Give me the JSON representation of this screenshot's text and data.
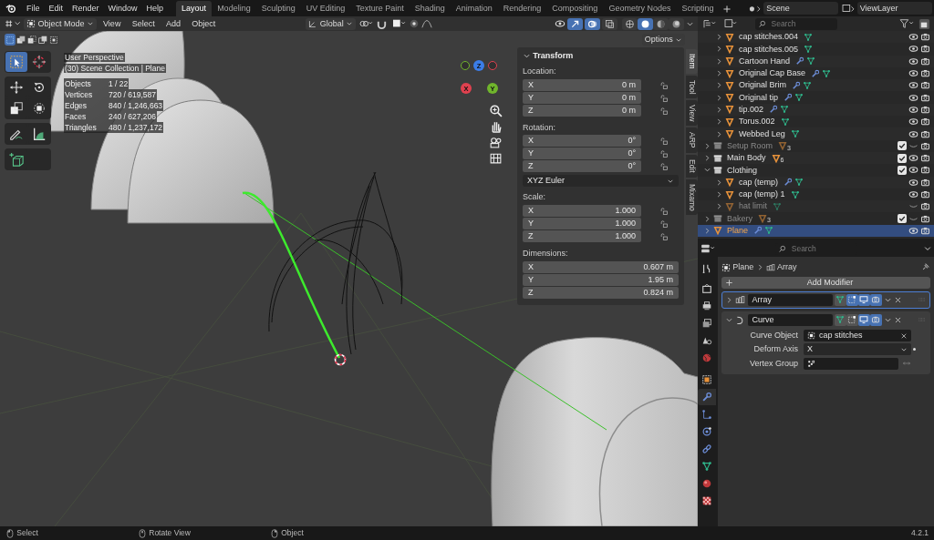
{
  "topbar": {
    "menus": [
      "File",
      "Edit",
      "Render",
      "Window",
      "Help"
    ],
    "workspaces": [
      {
        "label": "Layout",
        "selected": true
      },
      {
        "label": "Modeling",
        "selected": false
      },
      {
        "label": "Sculpting",
        "selected": false
      },
      {
        "label": "UV Editing",
        "selected": false
      },
      {
        "label": "Texture Paint",
        "selected": false
      },
      {
        "label": "Shading",
        "selected": false
      },
      {
        "label": "Animation",
        "selected": false
      },
      {
        "label": "Rendering",
        "selected": false
      },
      {
        "label": "Compositing",
        "selected": false
      },
      {
        "label": "Geometry Nodes",
        "selected": false
      },
      {
        "label": "Scripting",
        "selected": false
      }
    ],
    "scene": "Scene",
    "view_layer": "ViewLayer"
  },
  "viewport": {
    "mode": "Object Mode",
    "menus": [
      "View",
      "Select",
      "Add",
      "Object"
    ],
    "orientation": "Global",
    "options": "Options",
    "select_modes": [
      {
        "kind": "set",
        "selected": true
      },
      {
        "kind": "extend",
        "selected": false
      },
      {
        "kind": "subtract",
        "selected": false
      },
      {
        "kind": "invert",
        "selected": false
      },
      {
        "kind": "intersect",
        "selected": false
      }
    ],
    "toggles": [
      {
        "kind": "gizmo",
        "on": true
      },
      {
        "kind": "overlay",
        "on": true
      },
      {
        "kind": "xray",
        "on": false
      }
    ],
    "shading": [
      {
        "kind": "wireframe",
        "selected": false
      },
      {
        "kind": "solid",
        "selected": true
      },
      {
        "kind": "material",
        "selected": false
      },
      {
        "kind": "rendered",
        "selected": false
      }
    ],
    "view_name": "User Perspective",
    "collection": "(30) Scene Collection | Plane",
    "stats": [
      {
        "label": "Objects",
        "value": "1 / 22"
      },
      {
        "label": "Vertices",
        "value": "720 / 619,587"
      },
      {
        "label": "Edges",
        "value": "840 / 1,246,663"
      },
      {
        "label": "Faces",
        "value": "240 / 627,206"
      },
      {
        "label": "Triangles",
        "value": "480 / 1,237,172"
      }
    ],
    "tools": [
      {
        "kind": "select",
        "selected": true
      },
      {
        "kind": "cursor",
        "selected": false
      },
      {
        "kind": "move",
        "selected": false
      },
      {
        "kind": "rotate",
        "selected": false
      },
      {
        "kind": "scale",
        "selected": false
      },
      {
        "kind": "transform",
        "selected": false
      },
      {
        "kind": "annotate",
        "selected": false
      },
      {
        "kind": "measure",
        "selected": false
      },
      {
        "kind": "add-cube",
        "selected": false
      }
    ],
    "gizmo_axes": [
      {
        "label": "Z",
        "color": "#3b7de8"
      },
      {
        "label": "X",
        "color": "#e0414f"
      },
      {
        "label": "Y",
        "color": "#70b52c"
      }
    ]
  },
  "sidebar": {
    "title": "Transform",
    "groups": [
      {
        "kind": "vector",
        "label": "Location:",
        "locks": true,
        "fields": [
          {
            "axis": "X",
            "value": "0 m"
          },
          {
            "axis": "Y",
            "value": "0 m"
          },
          {
            "axis": "Z",
            "value": "0 m"
          }
        ]
      },
      {
        "kind": "vector",
        "label": "Rotation:",
        "locks": true,
        "fields": [
          {
            "axis": "X",
            "value": "0°"
          },
          {
            "axis": "Y",
            "value": "0°"
          },
          {
            "axis": "Z",
            "value": "0°"
          }
        ]
      },
      {
        "kind": "dropdown",
        "value": "XYZ Euler"
      },
      {
        "kind": "vector",
        "label": "Scale:",
        "locks": true,
        "fields": [
          {
            "axis": "X",
            "value": "1.000"
          },
          {
            "axis": "Y",
            "value": "1.000"
          },
          {
            "axis": "Z",
            "value": "1.000"
          }
        ]
      },
      {
        "kind": "vector",
        "label": "Dimensions:",
        "locks": false,
        "fields": [
          {
            "axis": "X",
            "value": "0.607 m"
          },
          {
            "axis": "Y",
            "value": "1.95 m"
          },
          {
            "axis": "Z",
            "value": "0.824 m"
          }
        ]
      }
    ],
    "tabs": [
      {
        "label": "Item",
        "selected": true
      },
      {
        "label": "Tool",
        "selected": false
      },
      {
        "label": "View",
        "selected": false
      },
      {
        "label": "ARP",
        "selected": false
      },
      {
        "label": "Edit",
        "selected": false
      },
      {
        "label": "Mixamo",
        "selected": false
      }
    ]
  },
  "outliner": {
    "search_placeholder": "Search",
    "rows": [
      {
        "kind": "continuation",
        "children": [
          {
            "kind": "object",
            "label": "cap stitches.004",
            "expanded": false,
            "modifier": false,
            "visible": true,
            "disabled": false,
            "selected": false
          },
          {
            "kind": "object",
            "label": "cap stitches.005",
            "expanded": false,
            "modifier": false,
            "visible": true,
            "disabled": false,
            "selected": false
          },
          {
            "kind": "object",
            "label": "Cartoon Hand",
            "expanded": false,
            "modifier": true,
            "visible": true,
            "disabled": false,
            "selected": false
          },
          {
            "kind": "object",
            "label": "Original Cap Base",
            "expanded": false,
            "modifier": true,
            "visible": true,
            "disabled": false,
            "selected": false
          },
          {
            "kind": "object",
            "label": "Original Brim",
            "expanded": false,
            "modifier": true,
            "visible": true,
            "disabled": false,
            "selected": false
          },
          {
            "kind": "object",
            "label": "Original tip",
            "expanded": false,
            "modifier": true,
            "visible": true,
            "disabled": false,
            "selected": false
          },
          {
            "kind": "object",
            "label": "tip.002",
            "expanded": false,
            "modifier": true,
            "visible": true,
            "disabled": false,
            "selected": false
          },
          {
            "kind": "object",
            "label": "Torus.002",
            "expanded": false,
            "modifier": false,
            "visible": true,
            "disabled": false,
            "selected": false
          },
          {
            "kind": "object",
            "label": "Webbed Leg",
            "expanded": false,
            "modifier": false,
            "visible": true,
            "disabled": false,
            "selected": false
          }
        ]
      },
      {
        "kind": "collection",
        "label": "Setup Room",
        "count": "3",
        "expanded": false,
        "checked": true,
        "visible": false,
        "disabled": true,
        "selected": false
      },
      {
        "kind": "collection",
        "label": "Main Body",
        "count": "6",
        "expanded": false,
        "checked": true,
        "visible": true,
        "disabled": false,
        "selected": false
      },
      {
        "kind": "collection",
        "label": "Clothing",
        "expanded": true,
        "checked": true,
        "visible": true,
        "disabled": false,
        "selected": false,
        "children": [
          {
            "kind": "object",
            "label": "cap (temp)",
            "expanded": false,
            "modifier": true,
            "visible": true,
            "disabled": false,
            "selected": false
          },
          {
            "kind": "object",
            "label": "cap (temp) 1",
            "expanded": false,
            "modifier": false,
            "visible": true,
            "disabled": false,
            "selected": false
          },
          {
            "kind": "object",
            "label": "hat limit",
            "expanded": false,
            "modifier": false,
            "visible": false,
            "disabled": true,
            "selected": false
          }
        ]
      },
      {
        "kind": "collection",
        "label": "Bakery",
        "count": "3",
        "expanded": false,
        "checked": true,
        "visible": false,
        "disabled": true,
        "selected": false
      },
      {
        "kind": "object",
        "label": "Plane",
        "expanded": false,
        "modifier": true,
        "visible": true,
        "disabled": false,
        "selected": true
      }
    ]
  },
  "properties": {
    "search_placeholder": "Search",
    "tabs": [
      {
        "kind": "tool",
        "selected": false
      },
      {
        "kind": "render",
        "selected": false
      },
      {
        "kind": "output",
        "selected": false
      },
      {
        "kind": "view_layer",
        "selected": false
      },
      {
        "kind": "scene",
        "selected": false
      },
      {
        "kind": "world",
        "selected": false
      },
      {
        "kind": "object",
        "selected": false
      },
      {
        "kind": "modifiers",
        "selected": true
      },
      {
        "kind": "particles",
        "selected": false
      },
      {
        "kind": "physics",
        "selected": false
      },
      {
        "kind": "constraints",
        "selected": false
      },
      {
        "kind": "data",
        "selected": false
      },
      {
        "kind": "material",
        "selected": false
      },
      {
        "kind": "texture",
        "selected": false
      }
    ],
    "breadcrumb": [
      "Plane",
      "Array"
    ],
    "add_button": "Add Modifier",
    "modifiers": [
      {
        "kind": "array",
        "name": "Array",
        "expanded": false,
        "active": true,
        "edit_mode": true,
        "viewport": true,
        "render": true
      },
      {
        "kind": "curve",
        "name": "Curve",
        "expanded": true,
        "active": false,
        "edit_mode": false,
        "viewport": true,
        "render": true,
        "fields": [
          {
            "kind": "object",
            "label": "Curve Object",
            "value": "cap stitches"
          },
          {
            "kind": "dropdown",
            "label": "Deform Axis",
            "value": "X"
          },
          {
            "kind": "group",
            "label": "Vertex Group"
          }
        ]
      }
    ]
  },
  "status_bar": {
    "hints": [
      {
        "kind": "left",
        "label": "Select"
      },
      {
        "kind": "middle",
        "label": "Rotate View"
      },
      {
        "kind": "right",
        "label": "Object"
      }
    ],
    "version": "4.2.1"
  }
}
